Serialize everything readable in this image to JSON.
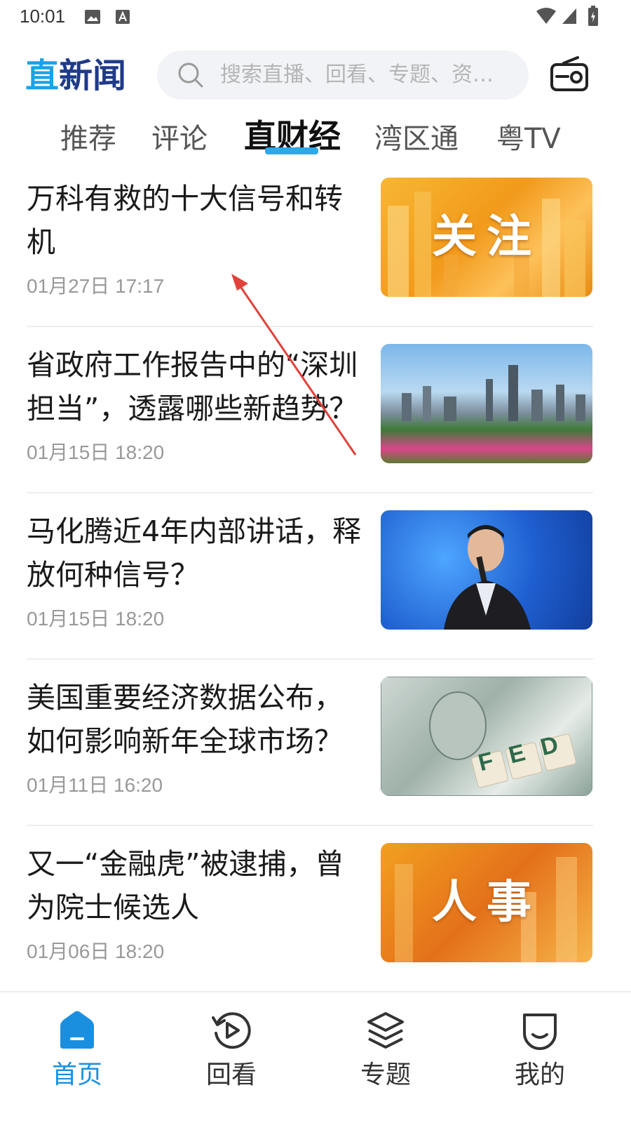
{
  "status_bar": {
    "time": "10:01"
  },
  "header": {
    "logo_first": "直",
    "logo_rest": "新闻",
    "search_placeholder": "搜索直播、回看、专题、资…"
  },
  "tabs": [
    {
      "label": "推荐"
    },
    {
      "label": "评论"
    },
    {
      "label": "直财经",
      "active": true
    },
    {
      "label": "湾区通"
    },
    {
      "label": "粤TV"
    }
  ],
  "news": [
    {
      "title": "万科有救的十大信号和转机",
      "date": "01月27日 17:17",
      "thumb_text": "关注"
    },
    {
      "title": "省政府工作报告中的“深圳担当”，透露哪些新趋势？",
      "date": "01月15日 18:20",
      "thumb_text": ""
    },
    {
      "title": "马化腾近4年内部讲话，释放何种信号？",
      "date": "01月15日 18:20",
      "thumb_text": ""
    },
    {
      "title": "美国重要经济数据公布，如何影响新年全球市场？",
      "date": "01月11日 16:20",
      "thumb_text": "FED"
    },
    {
      "title": "又一“金融虎”被逮捕，曾为院士候选人",
      "date": "01月06日 18:20",
      "thumb_text": "人事"
    }
  ],
  "bottom_nav": [
    {
      "label": "首页",
      "icon": "home-icon",
      "active": true
    },
    {
      "label": "回看",
      "icon": "replay-icon"
    },
    {
      "label": "专题",
      "icon": "layers-icon"
    },
    {
      "label": "我的",
      "icon": "profile-icon"
    }
  ],
  "colors": {
    "accent": "#1a8fe0",
    "tab_underline": "#2ea8e6",
    "annotation_arrow": "#e0413a"
  }
}
